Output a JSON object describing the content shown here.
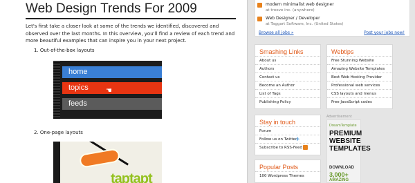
{
  "article": {
    "title": "Web Design Trends For 2009",
    "intro": "Let's first take a closer look at some of the trends we identified, discovered and observed over the last months. In this overview, you'll find a review of each trend and more beautiful examples that can inspire you in your next project.",
    "list": [
      {
        "number": "1.",
        "label": "Out-of-the-box layouts"
      },
      {
        "number": "2.",
        "label": "One-page layouts"
      }
    ],
    "nav_demo": {
      "home": "home",
      "topics": "topics",
      "feeds": "feeds"
    },
    "onepage_demo": {
      "word": "taptapt"
    }
  },
  "jobs": {
    "items": [
      {
        "title": "modern minimalist web designer",
        "meta": "at troove inc. (anywhere)"
      },
      {
        "title": "Web Designer / Developer",
        "meta": "at Taggart Software, Inc. (United States)"
      }
    ],
    "browse_link": "Browse all jobs »",
    "post_link": "Post your jobs now!"
  },
  "smashing_links": {
    "title": "Smashing Links",
    "items": [
      "About us",
      "Authors",
      "Contact us",
      "Become an Author",
      "List of Tags",
      "Publishing Policy"
    ]
  },
  "webtips": {
    "title": "Webtips",
    "items": [
      "Free Stunning Website",
      "Amazing Website Templates",
      "Best Web Hosting Provider",
      "Professional web services",
      "CSS layouts and menus",
      "Free JavaScript codes"
    ]
  },
  "stay_in_touch": {
    "title": "Stay in touch",
    "items": [
      "Forum",
      "Follow us on Twitter",
      "Subscribe to RSS-Feed"
    ]
  },
  "popular_posts": {
    "title": "Popular Posts",
    "items": [
      "100 Wordpress Themes"
    ]
  },
  "ad": {
    "label": "Advertisement",
    "brand": "DreamTemplate",
    "headline": "PREMIUM WEBSITE TEMPLATES",
    "download": "DOWNLOAD",
    "count": "3,000+",
    "amazing": "AMAZING"
  },
  "colors": {
    "heading_orange": "#e05a1a",
    "link_blue": "#1a54b8",
    "nav_blue": "#3a7fd5",
    "nav_red": "#e83512",
    "nav_gray": "#5b5b5b"
  }
}
